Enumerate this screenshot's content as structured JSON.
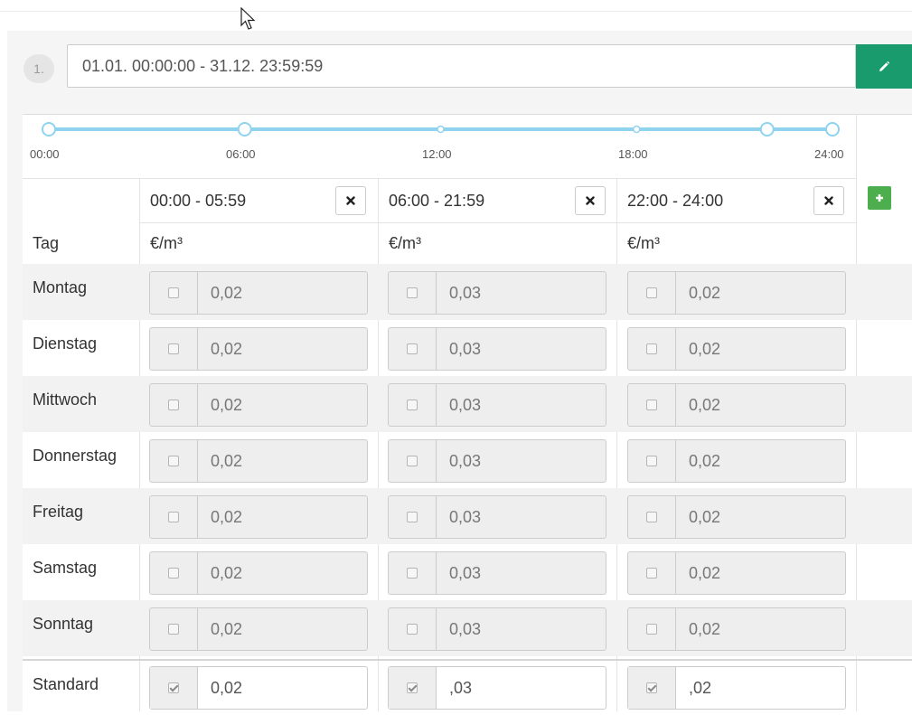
{
  "period": {
    "index": "1.",
    "range": "01.01. 00:00:00 - 31.12. 23:59:59"
  },
  "timeline": {
    "ticks": [
      "00:00",
      "06:00",
      "12:00",
      "18:00",
      "24:00"
    ],
    "handles_hours": [
      0,
      6,
      22,
      24
    ],
    "minor_points_hours": [
      12,
      18
    ]
  },
  "columns": [
    {
      "range": "00:00 - 05:59",
      "unit": "€/m³"
    },
    {
      "range": "06:00 - 21:59",
      "unit": "€/m³"
    },
    {
      "range": "22:00 - 24:00",
      "unit": "€/m³"
    }
  ],
  "header": {
    "day_column": "Tag"
  },
  "rows": [
    {
      "day": "Montag",
      "values": [
        "0,02",
        "0,03",
        "0,02"
      ],
      "checked": [
        false,
        false,
        false
      ]
    },
    {
      "day": "Dienstag",
      "values": [
        "0,02",
        "0,03",
        "0,02"
      ],
      "checked": [
        false,
        false,
        false
      ]
    },
    {
      "day": "Mittwoch",
      "values": [
        "0,02",
        "0,03",
        "0,02"
      ],
      "checked": [
        false,
        false,
        false
      ]
    },
    {
      "day": "Donnerstag",
      "values": [
        "0,02",
        "0,03",
        "0,02"
      ],
      "checked": [
        false,
        false,
        false
      ]
    },
    {
      "day": "Freitag",
      "values": [
        "0,02",
        "0,03",
        "0,02"
      ],
      "checked": [
        false,
        false,
        false
      ]
    },
    {
      "day": "Samstag",
      "values": [
        "0,02",
        "0,03",
        "0,02"
      ],
      "checked": [
        false,
        false,
        false
      ]
    },
    {
      "day": "Sonntag",
      "values": [
        "0,02",
        "0,03",
        "0,02"
      ],
      "checked": [
        false,
        false,
        false
      ]
    },
    {
      "day": "Standard",
      "values": [
        "0,02",
        ",03",
        ",02"
      ],
      "checked": [
        true,
        true,
        true
      ]
    }
  ],
  "colors": {
    "accent_green": "#1a9b6e",
    "add_green": "#4cae4c",
    "timeline_blue": "#8fd3ef"
  },
  "icons": {
    "edit": "pencil-icon",
    "delete": "close-icon",
    "add": "plus-icon"
  }
}
